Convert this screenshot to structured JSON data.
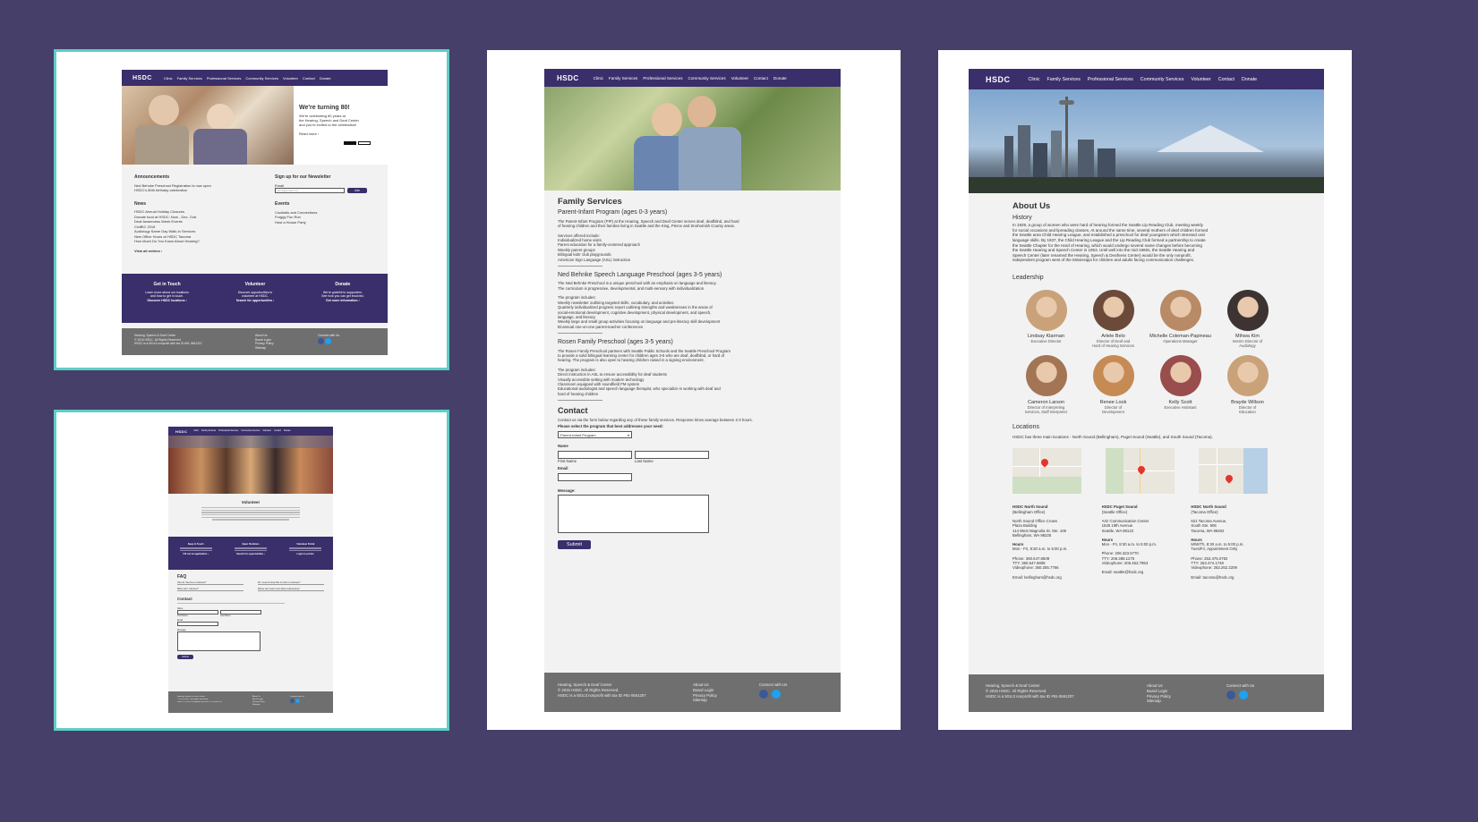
{
  "nav": {
    "logo": "HSDC",
    "items": [
      "Clinic",
      "Family Services",
      "Professional Services",
      "Community Services",
      "Volunteer",
      "Contact",
      "Donate"
    ]
  },
  "home": {
    "hero_title": "We're turning 80!",
    "hero_text": [
      "We're celebrating 80 years at",
      "the Hearing, Speech and Deaf Center",
      "and you're invited to the celebration!"
    ],
    "hero_link": "Read more ›",
    "announcements_title": "Announcements",
    "announcements": [
      "Ned Behnke Preschool Registration is now open",
      "HSDC's 80th birthday celebration"
    ],
    "news_title": "News",
    "news": [
      "HSDC Annual Holiday Closures",
      "Donate food at HSDC: Now - Dec. 21st",
      "Deaf Awareness Week Events",
      "CiviBIC 2016",
      "Audiology Same Day Walk-In Services",
      "New Office Hours at HSDC Tacoma",
      "How Much Do You Know About Hearing?"
    ],
    "view_all": "View all entries ›",
    "newsletter_title": "Sign up for our Newsletter",
    "email_label": "Email",
    "email_placeholder": "name@email.com",
    "join": "Join",
    "events_title": "Events",
    "events": [
      "Cocktails and Connections",
      "Froggy Fun Run",
      "Host a House Party"
    ],
    "cta": [
      {
        "title": "Get in Touch",
        "text": [
          "Learn more about our locations",
          "and how to get in touch."
        ],
        "link": "Discover HSDC locations ›"
      },
      {
        "title": "Volunteer",
        "text": [
          "Discover opportunities to",
          "volunteer at HSDC."
        ],
        "link": "Search for opportunities ›"
      },
      {
        "title": "Donate",
        "text": [
          "We're grateful to supporters.",
          "See how you can get involved."
        ],
        "link": "Get more information ›"
      }
    ]
  },
  "footer": {
    "org": "Hearing, Speech & Deaf Center",
    "copyright": "© 2016 HSDC. All Rights Reserved.",
    "tax": "HSDC is a 501c3 nonprofit with tax ID #91-0661207",
    "links": [
      "About Us",
      "Board Login",
      "Privacy Policy",
      "Sitemap"
    ],
    "connect": "Connect with Us"
  },
  "volunteer": {
    "title": "Volunteer",
    "cta": [
      {
        "title": "Keep in Touch",
        "link": "Fill out an application ›"
      },
      {
        "title": "Open Positions",
        "link": "Search for opportunities ›"
      },
      {
        "title": "Volunteer Portal",
        "link": "Login to portal ›"
      }
    ],
    "faq_title": "FAQ",
    "faq": [
      "How do I become a volunteer?",
      "Do I need to know ASL in order to volunteer?",
      "When can I volunteer?",
      "Where can I learn more about volunteering?"
    ],
    "contact_title": "Contact",
    "name_label": "Name",
    "first_name": "First Name",
    "last_name": "Last Name",
    "email_label": "Email",
    "message_label": "Message",
    "submit": "Submit"
  },
  "family": {
    "title": "Family Services",
    "programs": [
      {
        "heading": "Parent-Infant Program (ages 0-3 years)",
        "desc": [
          "The Parent-Infant Program (PIP) at the Hearing, Speech and Deaf Center serves deaf, deafblind, and hard",
          "of hearing children and their families living in Seattle and the King, Pierce and Snohomish County areas."
        ],
        "list_title": "Services offered include:",
        "list": [
          "Individualized home visits",
          "Parent education for a family-centered approach",
          "Weekly parent groups",
          "Bilingual kids' club playgrounds",
          "American Sign Language (ASL) instruction"
        ]
      },
      {
        "heading": "Ned Behnke Speech Language Preschool (ages 3-5 years)",
        "desc": [
          "The Ned Behnke Preschool is a unique preschool with an emphasis on language and literacy.",
          "The curriculum is progressive, developmental, and multi-sensory with individualization."
        ],
        "list_title": "The program includes:",
        "list": [
          "Weekly newsletter outlining targeted skills, vocabulary, and activities",
          "Quarterly individualized progress report outlining strengths and weaknesses in the areas of",
          "social-emotional development, cognitive development, physical development, and speech,",
          "language, and literacy",
          "Weekly large and small group activities focusing on language and pre-literacy skill development",
          "Bi-annual one-on-one parent-teacher conferences"
        ]
      },
      {
        "heading": "Rosen Family Preschool (ages 3-5 years)",
        "desc": [
          "The Rosen Family Preschool partners with Seattle Public Schools and the Seattle Preschool Program",
          "to provide a solid bilingual learning center for children ages 3-5 who are deaf, deafblind, or hard of",
          "hearing. The program is also open to hearing children raised in a signing environment."
        ],
        "list_title": "The program includes:",
        "list": [
          "Direct instruction in ASL to ensure accessibility for deaf students",
          "Visually accessible setting with modern technology",
          "Classroom equipped with soundfield FM system",
          "Educational audiologist and speech language therapist, who specialize in working with deaf and",
          "hard of hearing children"
        ]
      }
    ],
    "contact_title": "Contact",
    "contact_text": "Contact us via the form below regarding any of these family services. Response times average between 2-3 hours.",
    "select_label": "Please select the program that best addresses your need:",
    "select_value": "Parent-Infant Program",
    "name_label": "Name",
    "first_name": "First Name",
    "last_name": "Last Name",
    "email_label": "Email",
    "message_label": "Message:",
    "submit": "Submit"
  },
  "about": {
    "title": "About Us",
    "history_title": "History",
    "history": [
      "In 1929, a group of women who were hard of hearing formed the Seattle Lip Reading Club, meeting weekly",
      "for social occasions and lipreading classes. At around the same time, several mothers of deaf children formed",
      "the Seattle area Child Hearing League, and established a preschool for deaf youngsters which stressed oral",
      "language skills. By 1937, the Child Hearing League and the Lip Reading Club formed a partnership to create",
      "the Seattle Chapter for the Hard of Hearing, which would undergo several name changes before becoming",
      "the Seattle Hearing and Speech Center in 1953. Until well into the mid-1960s, the Seattle Hearing and",
      "Speech Center (later renamed the Hearing, Speech & Deafness Center) would be the only nonprofit,",
      "independent program west of the Mississippi for children and adults facing communication challenges."
    ],
    "leadership_title": "Leadership",
    "leaders": [
      {
        "name": "Lindsay Klarman",
        "role": [
          "Executive Director"
        ],
        "color": "#c9a27a"
      },
      {
        "name": "Arlele Belo",
        "role": [
          "Director of Deaf and",
          "Hard of Hearing Services"
        ],
        "color": "#6b4a3a"
      },
      {
        "name": "Michelle Coleman-Papineau",
        "role": [
          "Operations Manager"
        ],
        "color": "#b88a66"
      },
      {
        "name": "Mihwa Kim",
        "role": [
          "Interim Director of",
          "Audiology"
        ],
        "color": "#3d3333"
      },
      {
        "name": "Cameron Larson",
        "role": [
          "Director of Interpreting",
          "Services, Staff Interpreter"
        ],
        "color": "#a37554"
      },
      {
        "name": "Renee Look",
        "role": [
          "Director of",
          "Development"
        ],
        "color": "#c68a55"
      },
      {
        "name": "Kelly Scott",
        "role": [
          "Executive Assistant"
        ],
        "color": "#9a4d4d"
      },
      {
        "name": "Brayde Willson",
        "role": [
          "Director of",
          "Education"
        ],
        "color": "#c9a27a"
      }
    ],
    "locations_title": "Locations",
    "locations_text": "HSDC has three main locations - North Sound (Bellingham), Puget Sound (Seattle), and South Sound (Tacoma).",
    "locations": [
      {
        "name": "HSDC North Sound",
        "sub": "(Bellingham Office)",
        "address": [
          "North Sound Office Crown",
          "Plaza Building",
          "114 West Magnolia St. Ste. 106",
          "Bellingham, WA 98225"
        ],
        "hours_title": "Hours",
        "hours": [
          "Mon - Fri, 8:30 a.m. to 5:00 p.m."
        ],
        "contact": [
          "Phone: 360.647.8508",
          "TTY: 360.647.5808",
          "Videophone: 360.255.7766"
        ],
        "email": "Email: bellingham@hsdc.org"
      },
      {
        "name": "HSDC Puget Sound",
        "sub": "(Seattle Office)",
        "address": [
          "Artz Communication Center",
          "1625 19th Avenue",
          "Seattle, WA 98122"
        ],
        "hours_title": "Hours",
        "hours": [
          "Mon - Fri, 8:30 a.m. to 5:00 p.m."
        ],
        "contact": [
          "Phone: 206.323.5770",
          "TTY: 206.388.1275",
          "Videophone: 206.452.7953"
        ],
        "email": "Email: seattle@hsdc.org"
      },
      {
        "name": "HSDC North Sound",
        "sub": "(Tacoma Office)",
        "address": [
          "621 Tacoma Avenue,",
          "South Ste. 505",
          "Tacoma, WA 98402"
        ],
        "hours_title": "Hours",
        "hours": [
          "M/W/Th, 8:30 a.m. to 5:00 p.m.",
          "Tues/Fri, Appointment Only"
        ],
        "contact": [
          "Phone: 253.475.0782",
          "TTY: 253.474.1748",
          "Videophone: 253.262.2209"
        ],
        "email": "Email: tacoma@hsdc.org"
      }
    ]
  },
  "colors": {
    "background": "#463f69",
    "brand_purple": "#3a2e6b",
    "selection": "#5fcdc4",
    "footer": "#6f6f6f"
  }
}
